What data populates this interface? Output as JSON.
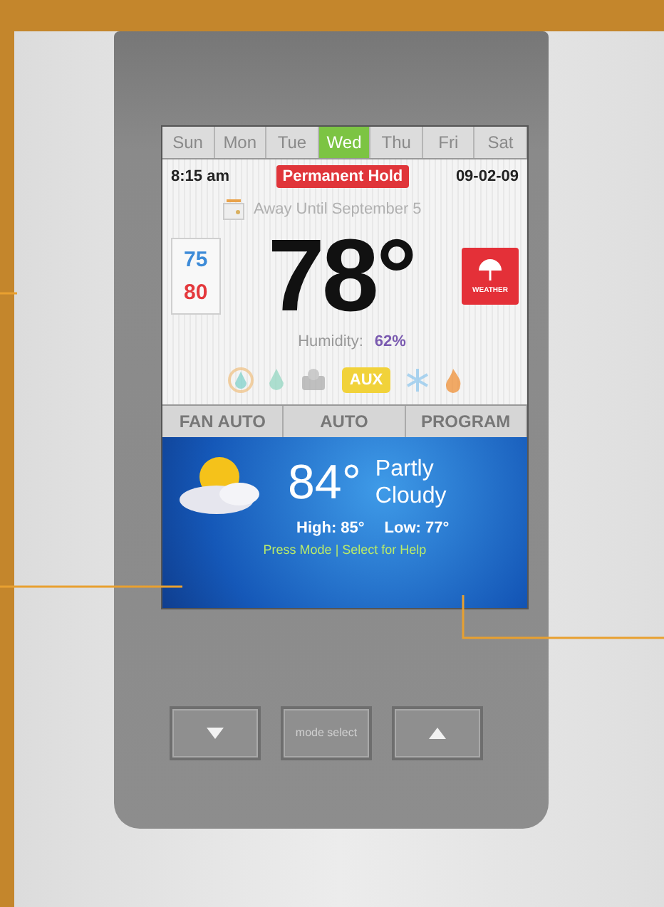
{
  "days": [
    {
      "label": "Sun",
      "selected": false
    },
    {
      "label": "Mon",
      "selected": false
    },
    {
      "label": "Tue",
      "selected": false
    },
    {
      "label": "Wed",
      "selected": true
    },
    {
      "label": "Thu",
      "selected": false
    },
    {
      "label": "Fri",
      "selected": false
    },
    {
      "label": "Sat",
      "selected": false
    }
  ],
  "status": {
    "time": "8:15 am",
    "hold": "Permanent Hold",
    "date": "09-02-09"
  },
  "away": "Away Until September 5",
  "setpoints": [
    {
      "value": "75",
      "kind": "cool"
    },
    {
      "value": "80",
      "kind": "heat"
    }
  ],
  "temperature": "78°",
  "weather_button": "WEATHER",
  "humidity": {
    "label": "Humidity:",
    "value": "62%"
  },
  "modes": [
    {
      "kind": "cool",
      "selected": false
    },
    {
      "kind": "drop",
      "selected": false
    },
    {
      "kind": "fan",
      "selected": false
    },
    {
      "kind": "aux",
      "label": "AUX",
      "selected": true
    },
    {
      "kind": "snow",
      "selected": false
    },
    {
      "kind": "flame",
      "selected": false
    }
  ],
  "soft_keys": [
    "FAN AUTO",
    "AUTO",
    "PROGRAM"
  ],
  "forecast": {
    "temperature": "84°",
    "condition": "Partly Cloudy",
    "high": "High: 85°",
    "low": "Low: 77°",
    "hint": "Press Mode | Select for Help"
  },
  "buttons": [
    {
      "kind": "down"
    },
    {
      "kind": "mode",
      "label": "mode select"
    },
    {
      "kind": "up"
    }
  ]
}
